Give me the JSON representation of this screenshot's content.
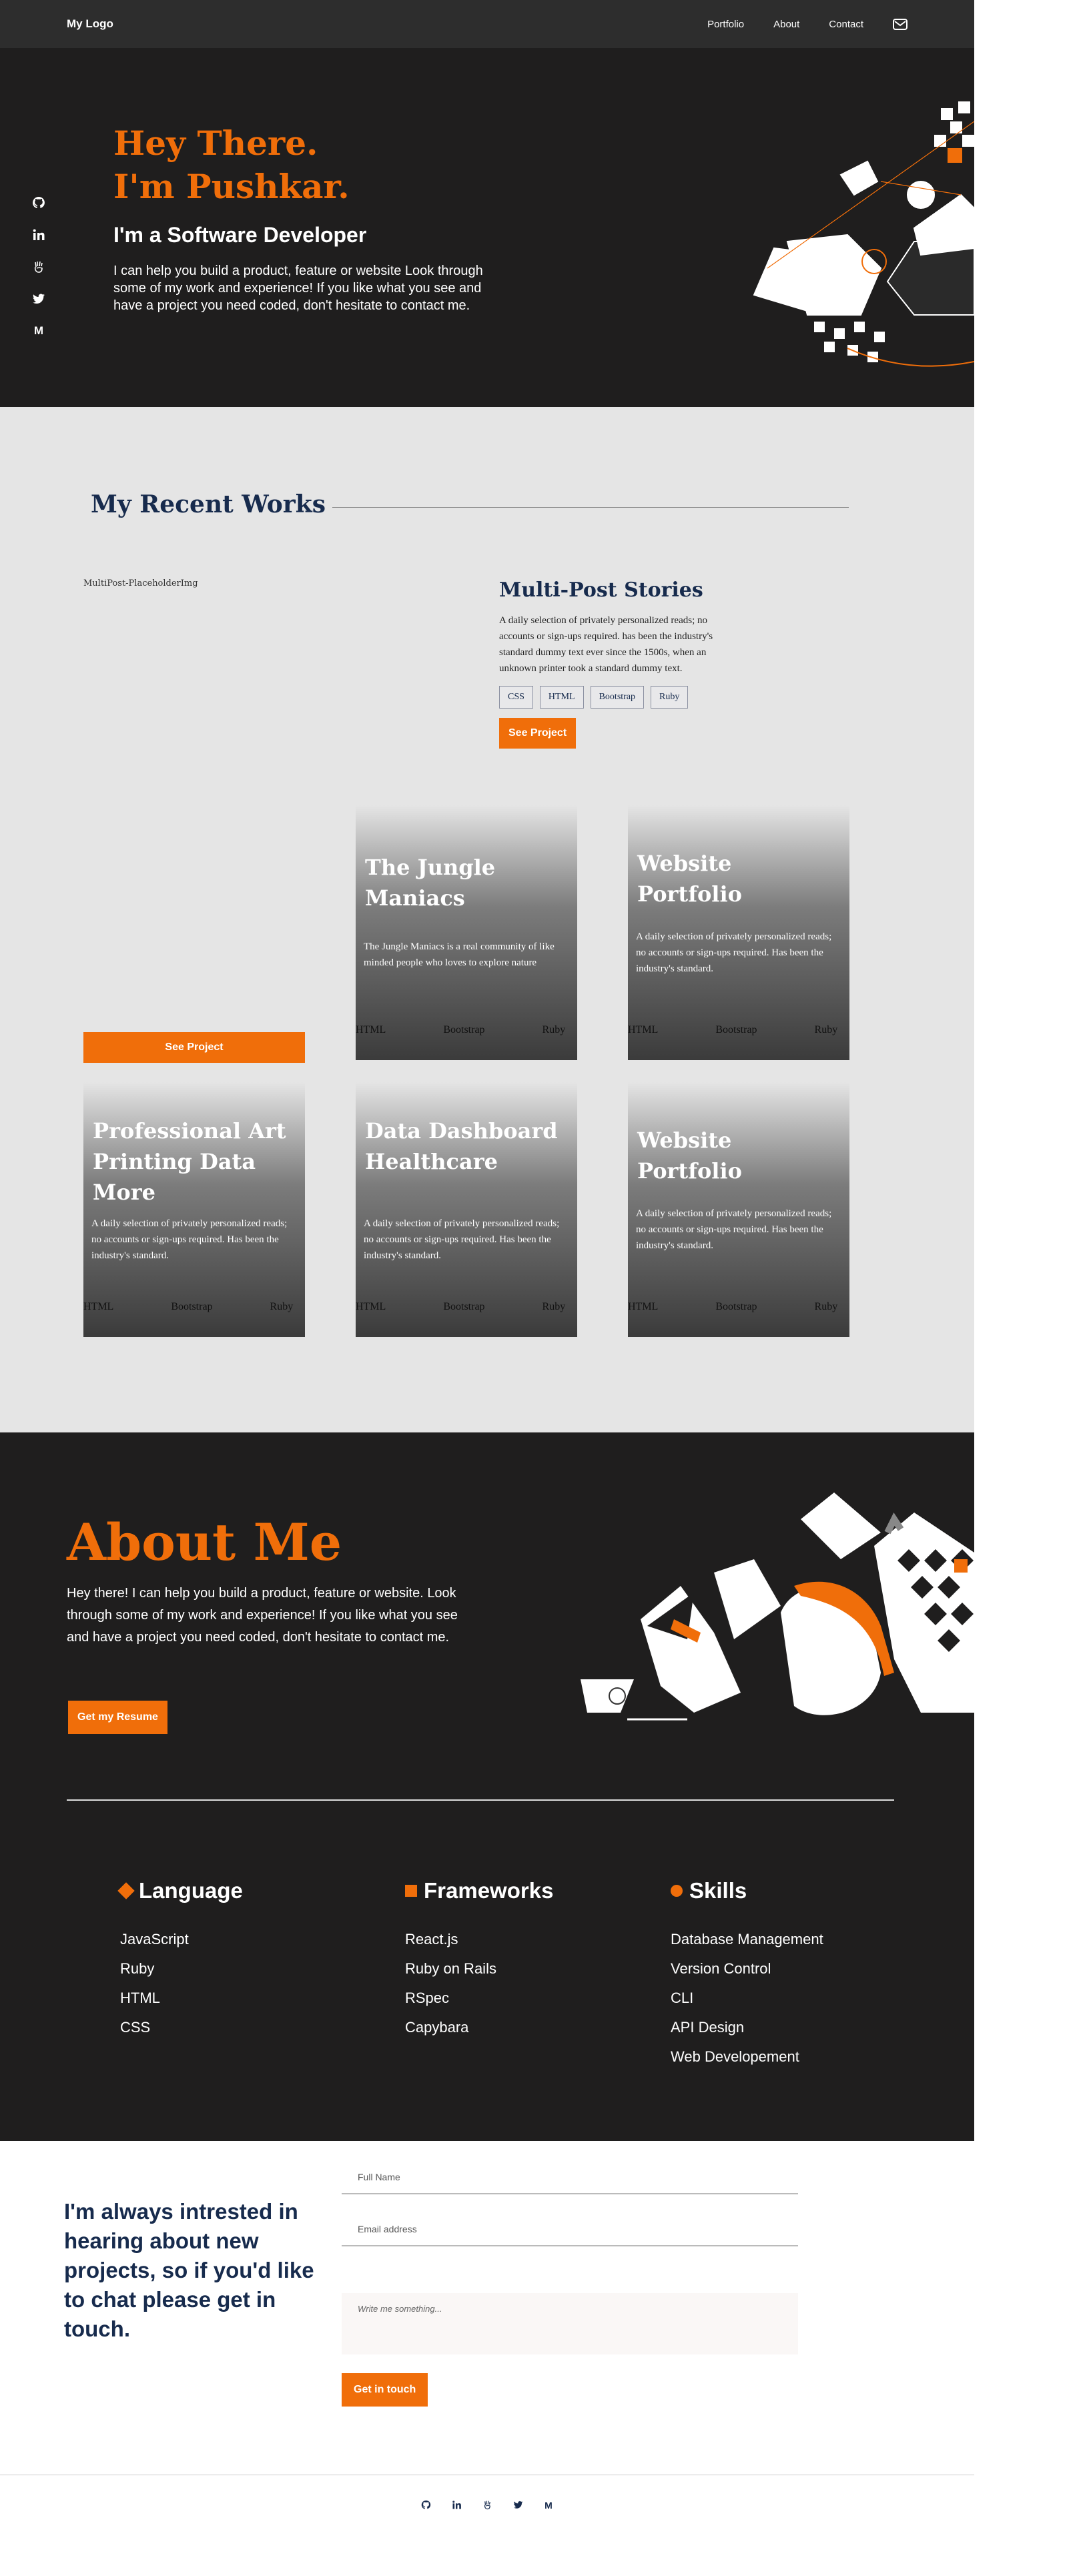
{
  "nav": {
    "logo": "My Logo",
    "links": [
      "Portfolio",
      "About",
      "Contact"
    ]
  },
  "hero": {
    "title_line1": "Hey There.",
    "title_line2": "I'm Pushkar.",
    "subtitle": "I'm a Software Developer",
    "description": "I can help you build a product, feature or website Look through some of my work and experience! If you like what you see and have a project you need coded, don't hesitate to contact me."
  },
  "social": {
    "medium": "M"
  },
  "works": {
    "title": "My Recent Works",
    "feature": {
      "image_alt": "MultiPost-PlaceholderImg",
      "title": "Multi-Post Stories",
      "description": "A daily selection of privately personalized reads; no accounts or sign-ups required. has been the industry's standard dummy text ever since the 1500s, when an unknown printer took a standard dummy text.",
      "tags": [
        "CSS",
        "HTML",
        "Bootstrap",
        "Ruby"
      ],
      "button": "See Project"
    },
    "card_button": "See Project",
    "cards": [
      {
        "title": "The Jungle Maniacs",
        "description": "The Jungle Maniacs is a real community of like minded people who loves to explore nature",
        "tags": [
          "HTML",
          "Bootstrap",
          "Ruby"
        ]
      },
      {
        "title": "Website Portfolio",
        "description": "A daily selection of privately personalized reads; no accounts or sign-ups required. Has been the industry's standard.",
        "tags": [
          "HTML",
          "Bootstrap",
          "Ruby"
        ]
      },
      {
        "title": "Professional Art Printing Data More",
        "description": "A daily selection of privately personalized reads; no accounts or sign-ups required. Has been the industry's standard.",
        "tags": [
          "HTML",
          "Bootstrap",
          "Ruby"
        ]
      },
      {
        "title": "Data Dashboard Healthcare",
        "description": "A daily selection of privately personalized reads; no accounts or sign-ups required. Has been the industry's standard.",
        "tags": [
          "HTML",
          "Bootstrap",
          "Ruby"
        ]
      },
      {
        "title": "Website Portfolio",
        "description": "A daily selection of privately personalized reads; no accounts or sign-ups required. Has been the industry's standard.",
        "tags": [
          "HTML",
          "Bootstrap",
          "Ruby"
        ]
      }
    ]
  },
  "about": {
    "title": "About Me",
    "description": "Hey there! I can help you build a product, feature or website. Look through some of my work and experience! If you like what you see and have a project you need coded, don't hesitate to contact me.",
    "button": "Get my Resume",
    "columns": [
      {
        "title": "Language",
        "items": [
          "JavaScript",
          "Ruby",
          "HTML",
          "CSS"
        ]
      },
      {
        "title": "Frameworks",
        "items": [
          "React.js",
          "Ruby on Rails",
          "RSpec",
          "Capybara"
        ]
      },
      {
        "title": "Skills",
        "items": [
          "Database Management",
          "Version Control",
          "CLI",
          "API Design",
          "Web Developement"
        ]
      }
    ]
  },
  "contact": {
    "text": "I'm always intrested in hearing about new projects, so if you'd like to chat please get in touch.",
    "name_placeholder": "Full Name",
    "email_placeholder": "Email address",
    "message_placeholder": "Write me something...",
    "button": "Get in touch"
  },
  "colors": {
    "accent": "#f06e0a",
    "dark": "#1f1e1e",
    "navy": "#172b4d"
  }
}
